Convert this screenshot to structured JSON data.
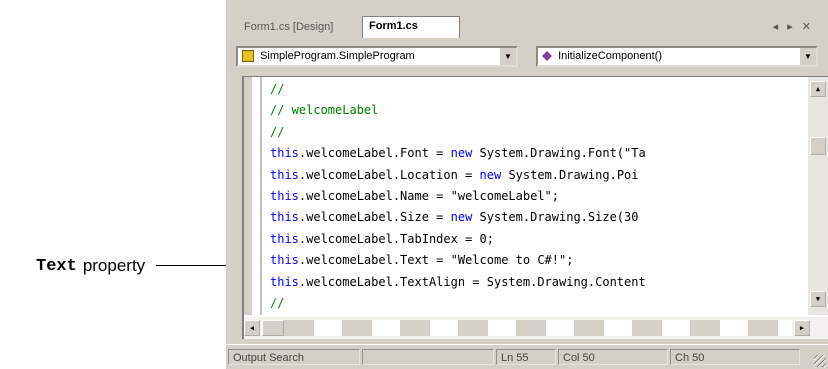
{
  "callout": {
    "code": "Text",
    "word": "property"
  },
  "window": {
    "tabs": [
      {
        "label": "Form1.cs [Design]",
        "active": false
      },
      {
        "label": "Form1.cs",
        "active": true
      }
    ],
    "controls": "◂ ▸ ✕",
    "class_combo": {
      "value": "SimpleProgram.SimpleProgram"
    },
    "member_combo": {
      "value": "InitializeComponent()"
    },
    "code_lines": [
      {
        "parts": [
          {
            "t": "//",
            "k": "cm"
          }
        ]
      },
      {
        "parts": [
          {
            "t": "// welcomeLabel",
            "k": "cm"
          }
        ]
      },
      {
        "parts": [
          {
            "t": "//",
            "k": "cm"
          }
        ]
      },
      {
        "parts": [
          {
            "t": "this",
            "k": "kw"
          },
          {
            "t": ".welcomeLabel.Font = ",
            "k": ""
          },
          {
            "t": "new",
            "k": "kw"
          },
          {
            "t": " System.Drawing.Font(\"Ta",
            "k": ""
          }
        ]
      },
      {
        "parts": [
          {
            "t": "this",
            "k": "kw"
          },
          {
            "t": ".welcomeLabel.Location = ",
            "k": ""
          },
          {
            "t": "new",
            "k": "kw"
          },
          {
            "t": " System.Drawing.Poi",
            "k": ""
          }
        ]
      },
      {
        "parts": [
          {
            "t": "this",
            "k": "kw"
          },
          {
            "t": ".welcomeLabel.Name = \"welcomeLabel\";",
            "k": ""
          }
        ]
      },
      {
        "parts": [
          {
            "t": "this",
            "k": "kw"
          },
          {
            "t": ".welcomeLabel.Size = ",
            "k": ""
          },
          {
            "t": "new",
            "k": "kw"
          },
          {
            "t": " System.Drawing.Size(30",
            "k": ""
          }
        ]
      },
      {
        "parts": [
          {
            "t": "this",
            "k": "kw"
          },
          {
            "t": ".welcomeLabel.TabIndex = 0;",
            "k": ""
          }
        ]
      },
      {
        "parts": [
          {
            "t": "this",
            "k": "kw"
          },
          {
            "t": ".welcomeLabel.Text = \"Welcome to C#!\";",
            "k": ""
          }
        ]
      },
      {
        "parts": [
          {
            "t": "this",
            "k": "kw"
          },
          {
            "t": ".welcomeLabel.TextAlign = System.Drawing.Content",
            "k": ""
          }
        ]
      },
      {
        "parts": [
          {
            "t": "//",
            "k": "cm"
          }
        ]
      }
    ],
    "status": {
      "ready": "Output  Search",
      "blank": "",
      "ln": "Ln 55",
      "col": "Col 50",
      "ch": "Ch 50"
    },
    "colors": {
      "keyword": "#0000ff",
      "comment": "#008000",
      "chrome": "#d4d0c8"
    }
  }
}
